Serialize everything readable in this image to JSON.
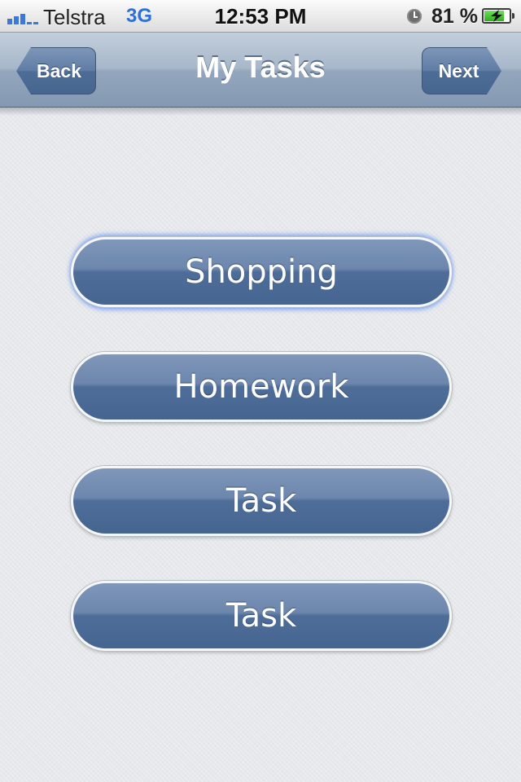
{
  "status_bar": {
    "carrier": "Telstra",
    "network": "3G",
    "time": "12:53 PM",
    "battery": "81 %",
    "battery_level": 0.81,
    "signal_icon": "signal-bars-icon",
    "alarm_icon": "alarm-clock-icon",
    "battery_icon": "battery-charging-icon"
  },
  "nav_bar": {
    "title": "My Tasks",
    "back_label": "Back",
    "next_label": "Next"
  },
  "tasks": [
    {
      "label": "Shopping",
      "selected": true
    },
    {
      "label": "Homework",
      "selected": false
    },
    {
      "label": "Task",
      "selected": false
    },
    {
      "label": "Task",
      "selected": false
    }
  ],
  "colors": {
    "button_blue": "#4f6d99",
    "nav_bar": "#a7b7ca",
    "highlight": "#2f6fd8",
    "background": "#e6e8eb"
  }
}
